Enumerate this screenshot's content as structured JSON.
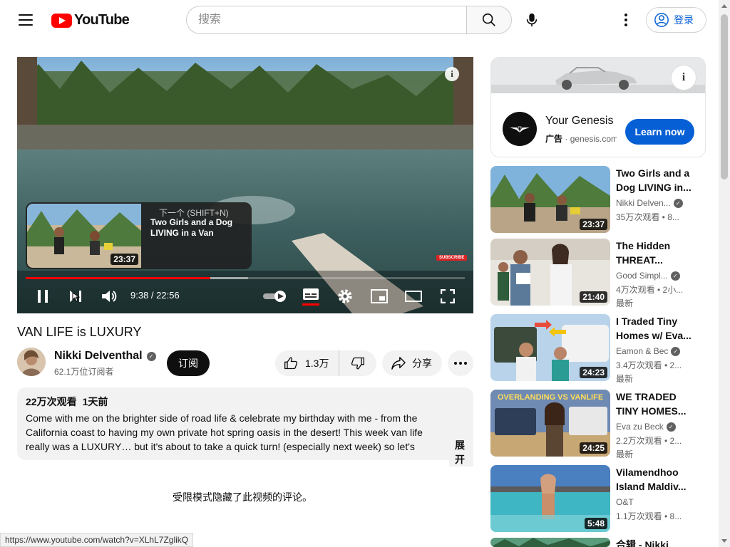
{
  "header": {
    "logo_text": "YouTube",
    "search_placeholder": "搜索",
    "signin_label": "登录"
  },
  "player": {
    "next_label": "下一个 (SHIFT+N)",
    "next_title": "Two Girls and a Dog LIVING in a Van",
    "next_duration": "23:37",
    "time_display": "9:38 / 22:56",
    "progress_played": 0.42,
    "progress_buffered": 0.507,
    "watermark": "SUBSCRIBE",
    "info_glyph": "i"
  },
  "video": {
    "title": "VAN LIFE is LUXURY",
    "channel_name": "Nikki Delventhal",
    "subscribers": "62.1万位订阅者",
    "subscribe_label": "订阅",
    "like_count": "1.3万",
    "share_label": "分享"
  },
  "description": {
    "views": "22万次观看",
    "date": "1天前",
    "text": "Come with me on the brighter side of road life & celebrate my birthday with me - from the California coast to having my own private hot spring oasis in the desert! This week van life really was a LUXURY… but it's about to take a quick turn! (especially next week) so let's celebrate the more",
    "expand_label": "展开"
  },
  "comments_notice": "受限模式隐藏了此视频的评论。",
  "status_url": "https://www.youtube.com/watch?v=XLhL7ZglikQ",
  "ad": {
    "title": "Your Genesis",
    "badge": "广告",
    "domain": "genesis.com",
    "cta": "Learn now"
  },
  "recommendations": [
    {
      "title_line1": "Two Girls and a",
      "title_line2": "Dog LIVING in...",
      "channel": "Nikki Delven...",
      "meta": "35万次观看 • 8...",
      "badge": "",
      "duration": "23:37",
      "verified": true
    },
    {
      "title_line1": "The Hidden",
      "title_line2": "THREAT...",
      "channel": "Good Simpl...",
      "meta": "4万次观看 • 2小...",
      "badge": "最新",
      "duration": "21:40",
      "verified": true
    },
    {
      "title_line1": "I Traded Tiny",
      "title_line2": "Homes w/ Eva...",
      "channel": "Eamon & Bec",
      "meta": "3.4万次观看 • 2...",
      "badge": "最新",
      "duration": "24:23",
      "verified": true
    },
    {
      "title_line1": "WE TRADED",
      "title_line2": "TINY HOMES...",
      "channel": "Eva zu Beck",
      "meta": "2.2万次观看 • 2...",
      "badge": "最新",
      "duration": "24:25",
      "verified": true
    },
    {
      "title_line1": "Vilamendhoo",
      "title_line2": "Island Maldiv...",
      "channel": "O&T",
      "meta": "1.1万次观看 • 8...",
      "badge": "",
      "duration": "5:48",
      "verified": false
    },
    {
      "title_line1": "合辑 - Nikki",
      "title_line2": "",
      "channel": "",
      "meta": "",
      "badge": "",
      "duration": "",
      "verified": false
    }
  ],
  "rec_thumb_texts": {
    "overlanding": "OVERLANDING VS VANLIFE"
  },
  "colors": {
    "brand_red": "#ff0000",
    "link_blue": "#065fd4",
    "text": "#0f0f0f",
    "secondary": "#606060"
  }
}
